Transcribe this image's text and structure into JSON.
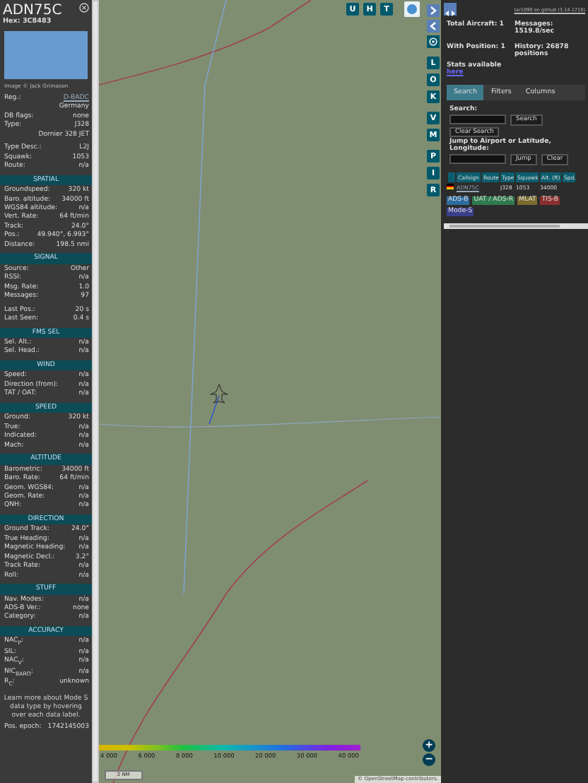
{
  "detail": {
    "title": "ADN75C",
    "hex_label": "Hex:",
    "hex": "3C8483",
    "image_credit": "Image © Jack Grimason",
    "info_groups": [
      [
        {
          "label": "Reg.:",
          "value": "D-BADC",
          "link": true
        },
        {
          "value": "Germany",
          "link": false
        },
        {
          "label": "DB flags:",
          "value": "none",
          "link": false
        },
        {
          "label": "Type:",
          "value": "J328",
          "link": false
        },
        {
          "value": "Dornier 328 JET",
          "link": false
        }
      ],
      [
        {
          "label": "Type Desc.:",
          "value": "L2J",
          "link": false
        },
        {
          "label": "Squawk:",
          "value": "1053",
          "link": false
        },
        {
          "label": "Route:",
          "value": "n/a",
          "link": false
        }
      ]
    ],
    "sections": [
      {
        "title": "SPATIAL",
        "groups": [
          [
            {
              "label": "Groundspeed:",
              "value": "320 kt"
            },
            {
              "label": "Baro. altitude:",
              "value": "34000 ft"
            },
            {
              "label": "WGS84 altitude:",
              "value": "n/a"
            },
            {
              "label": "Vert. Rate:",
              "value": "64 ft/min"
            },
            {
              "label": "Track:",
              "value": "24.0°"
            },
            {
              "label": "Pos.:",
              "value": "49.940°, 6.993°"
            },
            {
              "label": "Distance:",
              "value": "198.5 nmi"
            }
          ]
        ]
      },
      {
        "title": "SIGNAL",
        "groups": [
          [
            {
              "label": "Source:",
              "value": "Other"
            },
            {
              "label": "RSSI:",
              "value": "n/a"
            },
            {
              "label": "Msg. Rate:",
              "value": "1.0"
            },
            {
              "label": "Messages:",
              "value": "97"
            }
          ],
          [
            {
              "label": "Last Pos.:",
              "value": "20 s"
            },
            {
              "label": "Last Seen:",
              "value": "0.4 s"
            }
          ]
        ]
      },
      {
        "title": "FMS SEL",
        "groups": [
          [
            {
              "label": "Sel. Alt.:",
              "value": "n/a"
            },
            {
              "label": "Sel. Head.:",
              "value": "n/a"
            }
          ]
        ]
      },
      {
        "title": "WIND",
        "groups": [
          [
            {
              "label": "Speed:",
              "value": "n/a"
            },
            {
              "label": "Direction (from):",
              "value": "n/a"
            },
            {
              "label": "TAT / OAT:",
              "value": "n/a"
            }
          ]
        ]
      },
      {
        "title": "SPEED",
        "groups": [
          [
            {
              "label": "Ground:",
              "value": "320 kt"
            },
            {
              "label": "True:",
              "value": "n/a"
            },
            {
              "label": "Indicated:",
              "value": "n/a"
            },
            {
              "label": "Mach:",
              "value": "n/a"
            }
          ]
        ]
      },
      {
        "title": "ALTITUDE",
        "groups": [
          [
            {
              "label": "Barometric:",
              "value": "34000 ft"
            },
            {
              "label": "Baro. Rate:",
              "value": "64 ft/min"
            },
            {
              "label": "Geom. WGS84:",
              "value": "n/a"
            },
            {
              "label": "Geom. Rate:",
              "value": "n/a"
            },
            {
              "label": "QNH:",
              "value": "n/a"
            }
          ]
        ]
      },
      {
        "title": "DIRECTION",
        "groups": [
          [
            {
              "label": "Ground Track:",
              "value": "24.0°"
            },
            {
              "label": "True Heading:",
              "value": "n/a"
            },
            {
              "label": "Magnetic Heading:",
              "value": "n/a"
            },
            {
              "label": "Magnetic Decl.:",
              "value": "3.2°"
            },
            {
              "label": "Track Rate:",
              "value": "n/a"
            },
            {
              "label": "Roll:",
              "value": "n/a"
            }
          ]
        ]
      },
      {
        "title": "STUFF",
        "groups": [
          [
            {
              "label": "Nav. Modes:",
              "value": "n/a"
            },
            {
              "label": "ADS-B Ver.:",
              "value": "none"
            },
            {
              "label": "Category:",
              "value": "n/a"
            }
          ]
        ]
      },
      {
        "title": "ACCURACY",
        "groups": [
          [
            {
              "label": "NAC$_{P}$:",
              "value": "n/a"
            },
            {
              "label": "SIL:",
              "value": "n/a"
            },
            {
              "label": "NAC$_{V}$:",
              "value": "n/a"
            },
            {
              "label": "NIC$_{BARO}$:",
              "value": "n/a"
            },
            {
              "label": "R$_{C}$:",
              "value": "unknown"
            }
          ]
        ]
      }
    ],
    "note": "Learn more about Mode S data type by hovering over each data label.",
    "epoch_label": "Pos. epoch:",
    "epoch_value": "1742145003"
  },
  "map": {
    "top_buttons": [
      "U",
      "H",
      "T"
    ],
    "side_groups": [
      [
        "L",
        "O",
        "K"
      ],
      [
        "V",
        "M"
      ],
      [
        "P",
        "I",
        "R"
      ]
    ],
    "altitude_labels": [
      "4 000",
      "6 000",
      "8 000",
      "10 000",
      "20 000",
      "30 000",
      "40 000"
    ],
    "scale": "2 NM",
    "zoom_in": "+",
    "zoom_out": "−",
    "attribution": "© OpenStreetMap contributors."
  },
  "panel": {
    "version_link": "tar1090 on github (3.14.1718)",
    "stats": [
      {
        "label": "Total Aircraft:",
        "value": "1"
      },
      {
        "label": "Messages:",
        "value": "1519.8/sec"
      },
      {
        "label": "With Position:",
        "value": "1"
      },
      {
        "label": "History:",
        "value": "26878 positions"
      }
    ],
    "stats_text": "Stats available",
    "stats_link": "here",
    "tabs": [
      {
        "label": "Search",
        "selected": true
      },
      {
        "label": "Filters",
        "selected": false
      },
      {
        "label": "Columns",
        "selected": false
      }
    ],
    "search_label": "Search:",
    "search_button": "Search",
    "clear_search_button": "Clear Search",
    "jump_label": "Jump to Airport or Latitude, Longitude:",
    "jump_button": "Jump",
    "clear_button": "Clear",
    "columns": [
      "Callsign",
      "Route",
      "Type",
      "Squawk",
      "Alt. (ft)",
      "Spd."
    ],
    "rows": [
      {
        "cells": [
          "ADN75C",
          "",
          "J328",
          "1053",
          "34000",
          ""
        ],
        "selected": false
      }
    ],
    "legend": [
      {
        "label": "ADS-B",
        "color": "#2e6b9e"
      },
      {
        "label": "UAT / ADS-R",
        "color": "#2f7a4d"
      },
      {
        "label": "MLAT",
        "color": "#7a6a2c"
      },
      {
        "label": "TIS-B",
        "color": "#8a2f2f"
      },
      {
        "label": "Mode-S",
        "color": "#3a3f8a"
      }
    ]
  }
}
